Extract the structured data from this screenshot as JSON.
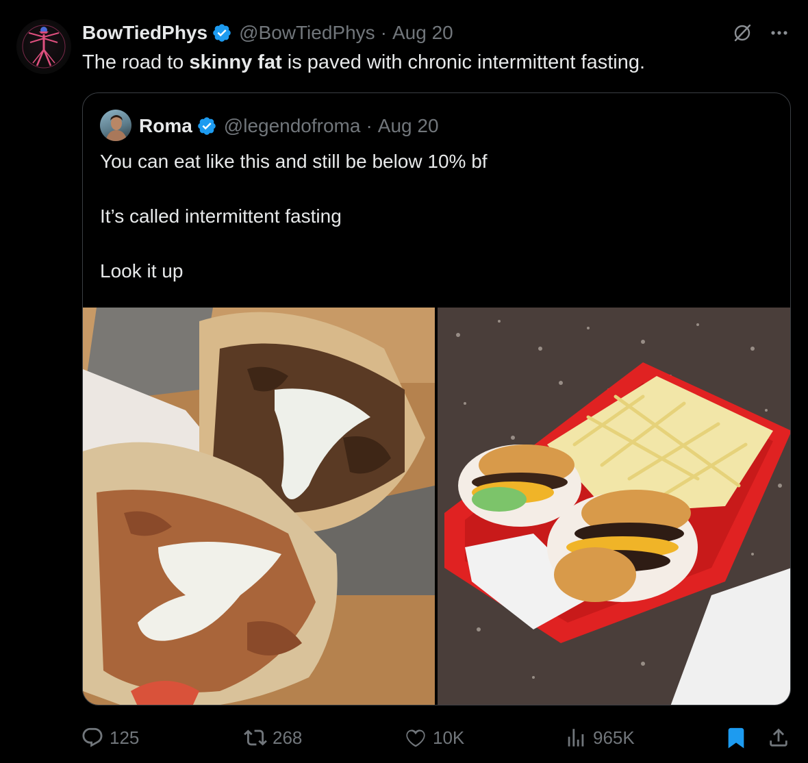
{
  "tweet": {
    "author_name": "BowTiedPhys",
    "handle": "@BowTiedPhys",
    "separator": "·",
    "date": "Aug 20",
    "text_before": "The road to ",
    "text_bold": "skinny fat",
    "text_after": " is paved with chronic intermittent fasting."
  },
  "quoted": {
    "author_name": "Roma",
    "handle": "@legendofroma",
    "separator": "·",
    "date": "Aug 20",
    "lines": [
      "You can eat like this and still be below 10% bf",
      "It’s called intermittent fasting",
      "Look it up"
    ]
  },
  "actions": {
    "replies": "125",
    "reposts": "268",
    "likes": "10K",
    "views": "965K"
  },
  "colors": {
    "background": "#000000",
    "text_primary": "#e7e9ea",
    "text_secondary": "#71767b",
    "verified_blue": "#1d9bf0",
    "bookmark_active": "#1d9bf0",
    "border": "#3b3f44"
  },
  "icons": {
    "verified": "verified-badge-icon",
    "grok": "grok-icon",
    "more": "more-icon",
    "reply": "reply-icon",
    "repost": "repost-icon",
    "like": "heart-icon",
    "views": "views-icon",
    "bookmark": "bookmark-icon",
    "share": "share-icon"
  }
}
